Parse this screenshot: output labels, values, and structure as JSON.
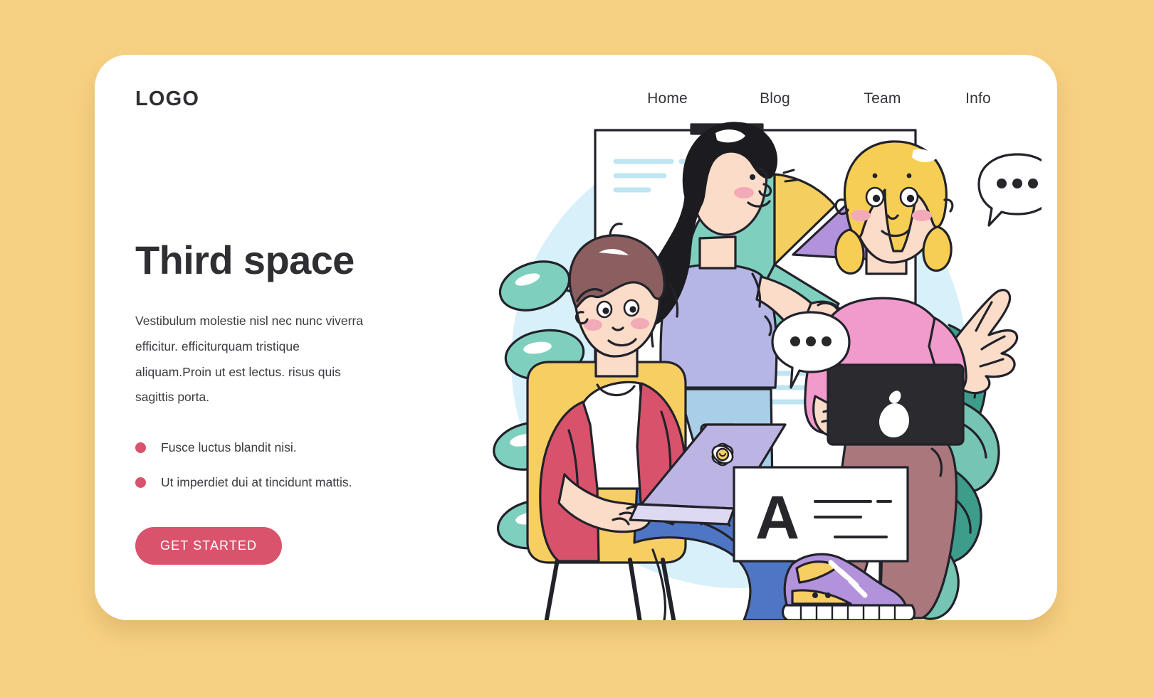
{
  "theme": {
    "page_background": "#F7D183",
    "card_background": "#FFFFFF",
    "accent": "#D8536B",
    "text_dark": "#2E2E33",
    "text_body": "#3B3B40"
  },
  "header": {
    "logo": "LOGO",
    "nav": [
      {
        "label": "Home"
      },
      {
        "label": "Blog"
      },
      {
        "label": "Team"
      },
      {
        "label": "Info"
      }
    ]
  },
  "hero": {
    "title": "Third space",
    "paragraph": "Vestibulum molestie nisl nec nunc viverra efficitur. efficiturquam tristique aliquam.Proin ut est lectus. risus quis sagittis porta.",
    "bullets": [
      {
        "text": "Fusce luctus blandit nisi."
      },
      {
        "text": "Ut imperdiet dui at tincidunt mattis."
      }
    ],
    "cta_label": "GET STARTED"
  },
  "illustration": {
    "name": "coworking-third-space-illustration",
    "backdrop_circle_color": "#D7F0FA",
    "whiteboard": {
      "board_color": "#FFFFFF",
      "header_bar_color": "#27272B",
      "text_line_color": "#BDE5F2",
      "pie_chart": {
        "type": "pie",
        "title": "",
        "slices": [
          {
            "label": "teal",
            "value": 45,
            "color": "#7FCFBE"
          },
          {
            "label": "yellow",
            "value": 22,
            "color": "#F4CE5E"
          },
          {
            "label": "purple",
            "value": 25,
            "color": "#B392DC"
          },
          {
            "label": "teal-lower",
            "value": 8,
            "color": "#7FCFBE"
          }
        ]
      }
    },
    "card_a": {
      "letter": "A",
      "background": "#FFFFFF"
    },
    "speech_bubbles": [
      {
        "dots": 3
      },
      {
        "dots": 3
      }
    ],
    "palette": {
      "plant_leaf": "#7FCFBE",
      "plant_leaf_dark": "#3E9C8A",
      "chair_yellow": "#F6CE62",
      "cardigan_red": "#D8526B",
      "shirt_white": "#FFFFFF",
      "jeans_blue": "#4E76C4",
      "presenter_top": "#B6B6E6",
      "presenter_jeans": "#A8CEE8",
      "sweater_pink": "#F09BCB",
      "pants_mauve": "#A9777C",
      "hair_blonde": "#F7CE54",
      "hair_black": "#1C1C20",
      "hair_brown": "#8B5F5F",
      "skin": "#FBDCC8",
      "laptop_lilac": "#BCB5E4",
      "laptop_dark": "#2B2B2F",
      "sneaker_purple": "#B392DC",
      "sneaker_yellow": "#F6CE62",
      "outline": "#22222A"
    }
  }
}
